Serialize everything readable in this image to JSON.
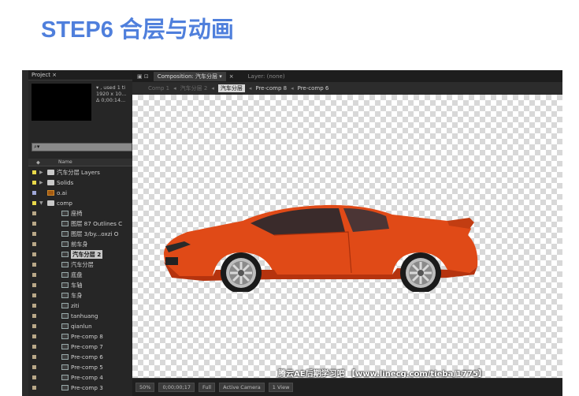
{
  "heading": "STEP6 合层与动画",
  "project_panel": {
    "tab_label": "Project ×",
    "tab_menu": "▾≡",
    "thumb_info": [
      "▾ , used 1 ti",
      "1920 x 10...",
      "Δ 0;00:14..."
    ],
    "search_placeholder": "⌕▾",
    "column_name": "Name",
    "items": [
      {
        "label": "汽车分层 Layers",
        "type": "folder",
        "indent": 0,
        "swatch": "#e8d84a",
        "twirl": "▶"
      },
      {
        "label": "Solids",
        "type": "folder",
        "indent": 0,
        "swatch": "#e8d84a",
        "twirl": "▶"
      },
      {
        "label": "o.ai",
        "type": "ai",
        "indent": 0,
        "swatch": "#a0a8d8",
        "twirl": ""
      },
      {
        "label": "comp",
        "type": "folder",
        "indent": 0,
        "swatch": "#e8d84a",
        "twirl": "▼"
      },
      {
        "label": "座椅",
        "type": "comp",
        "indent": 1,
        "swatch": "#b9a888",
        "twirl": ""
      },
      {
        "label": "图层 87 Outlines C",
        "type": "comp",
        "indent": 1,
        "swatch": "#b9a888",
        "twirl": ""
      },
      {
        "label": "图层 3/by...oxzi O",
        "type": "comp",
        "indent": 1,
        "swatch": "#b9a888",
        "twirl": ""
      },
      {
        "label": "前车身",
        "type": "comp",
        "indent": 1,
        "swatch": "#b9a888",
        "twirl": ""
      },
      {
        "label": "汽车分层 2",
        "type": "comp",
        "indent": 1,
        "swatch": "#b9a888",
        "twirl": "",
        "selected": true
      },
      {
        "label": "汽车分层",
        "type": "comp",
        "indent": 1,
        "swatch": "#b9a888",
        "twirl": ""
      },
      {
        "label": "底盘",
        "type": "comp",
        "indent": 1,
        "swatch": "#b9a888",
        "twirl": ""
      },
      {
        "label": "车轴",
        "type": "comp",
        "indent": 1,
        "swatch": "#b9a888",
        "twirl": ""
      },
      {
        "label": "车身",
        "type": "comp",
        "indent": 1,
        "swatch": "#b9a888",
        "twirl": ""
      },
      {
        "label": "ziti",
        "type": "comp",
        "indent": 1,
        "swatch": "#b9a888",
        "twirl": ""
      },
      {
        "label": "tanhuang",
        "type": "comp",
        "indent": 1,
        "swatch": "#b9a888",
        "twirl": ""
      },
      {
        "label": "qianlun",
        "type": "comp",
        "indent": 1,
        "swatch": "#b9a888",
        "twirl": ""
      },
      {
        "label": "Pre-comp 8",
        "type": "comp",
        "indent": 1,
        "swatch": "#b9a888",
        "twirl": ""
      },
      {
        "label": "Pre-comp 7",
        "type": "comp",
        "indent": 1,
        "swatch": "#b9a888",
        "twirl": ""
      },
      {
        "label": "Pre-comp 6",
        "type": "comp",
        "indent": 1,
        "swatch": "#b9a888",
        "twirl": ""
      },
      {
        "label": "Pre-comp 5",
        "type": "comp",
        "indent": 1,
        "swatch": "#b9a888",
        "twirl": ""
      },
      {
        "label": "Pre-comp 4",
        "type": "comp",
        "indent": 1,
        "swatch": "#b9a888",
        "twirl": ""
      },
      {
        "label": "Pre-comp 3",
        "type": "comp",
        "indent": 1,
        "swatch": "#b9a888",
        "twirl": ""
      }
    ]
  },
  "composition_panel": {
    "lock_icon": "🔓",
    "tab_label": "Composition: 汽车分层",
    "tab_menu": "▾",
    "tab_close": "×",
    "layer_label": "Layer: (none)",
    "breadcrumbs": [
      {
        "label": "Comp 1",
        "state": "dim"
      },
      {
        "label": "汽车分层 2",
        "state": "dim"
      },
      {
        "label": "汽车分层",
        "state": "current"
      },
      {
        "label": "Pre-comp 8",
        "state": "lit"
      },
      {
        "label": "Pre-comp 6",
        "state": "lit"
      }
    ],
    "separator": "◂",
    "status": {
      "zoom": "50%",
      "timecode": "0;00;00;17",
      "resolution": "Full",
      "camera": "Active Camera",
      "view": "1 View"
    }
  },
  "watermark": "腾云AE后期学习吧 【www.linecg.com/tieba/1775】",
  "colors": {
    "heading": "#4f7fdc",
    "car_body": "#e04a17",
    "car_shadow": "#b5330e",
    "window": "#3a2b2b"
  }
}
